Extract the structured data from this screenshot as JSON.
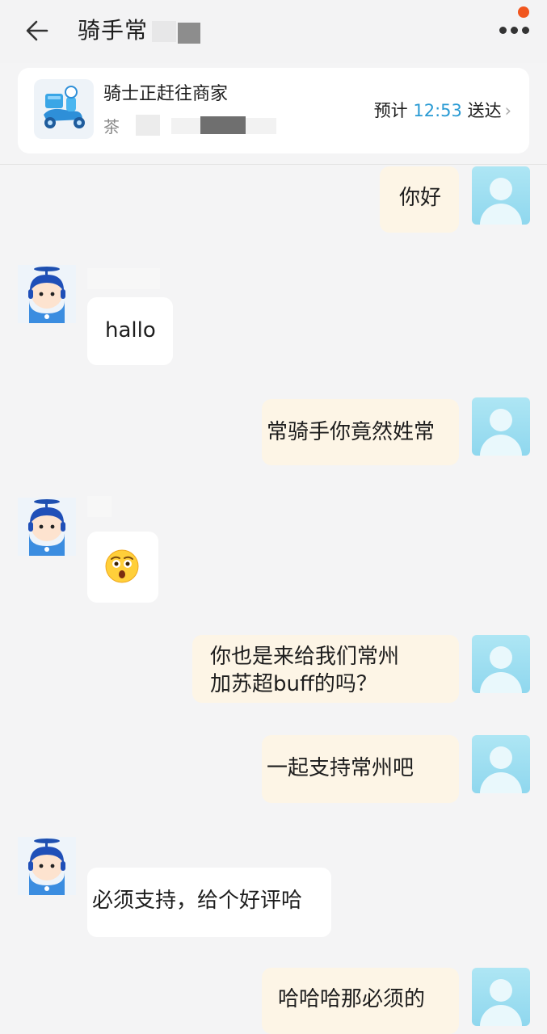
{
  "header": {
    "title": "骑手常",
    "back_icon": "back-arrow-icon",
    "more_icon": "more-dots-icon",
    "notification_color": "#f1561e"
  },
  "order": {
    "status": "骑士正赶往商家",
    "shop_name": "茶",
    "eta_prefix": "预计",
    "eta_time": "12:53",
    "eta_suffix": "送达",
    "eta_chevron": "›",
    "accent_color": "#2a9bd4",
    "illustration_icon": "delivery-scooter-icon"
  },
  "messages": [
    {
      "from": "me",
      "text": "你好"
    },
    {
      "from": "rider",
      "text": "hallo"
    },
    {
      "from": "me",
      "text": "常骑手你竟然姓常"
    },
    {
      "from": "rider",
      "emoji": "astonished-face-emoji"
    },
    {
      "from": "me",
      "lines": [
        "你也是来给我们常州",
        "加苏超buff的吗？"
      ]
    },
    {
      "from": "me",
      "text": "一起支持常州吧"
    },
    {
      "from": "rider",
      "text": "必须支持，给个好评哈"
    },
    {
      "from": "me",
      "text": "哈哈哈那必须的"
    }
  ],
  "colors": {
    "my_bubble": "#fdf5e6",
    "rider_bubble": "#ffffff",
    "background": "#f4f4f5"
  }
}
